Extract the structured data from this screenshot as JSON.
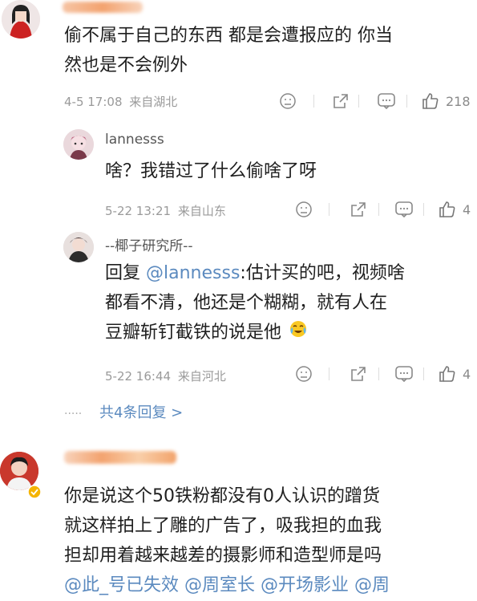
{
  "comment1": {
    "text_line1": "偷不属于自己的东西 都是会遭报应的 你当",
    "text_line2": "然也是不会例外",
    "time": "4-5 17:08",
    "location": "来自湖北",
    "likes": "218"
  },
  "reply1": {
    "username": "lannesss",
    "text": "啥？我错过了什么偷啥了呀",
    "time": "5-22 13:21",
    "location": "来自山东",
    "likes": "4"
  },
  "reply2": {
    "username": "--椰子研究所--",
    "prefix": "回复 ",
    "mention": "@lannesss",
    "text_line1_rest": ":估计买的吧，视频啥",
    "text_line2": "都看不清，他还是个糊糊，就有人在",
    "text_line3": "豆瓣斩钉截铁的说是他",
    "time": "5-22 16:44",
    "location": "来自河北",
    "likes": "4"
  },
  "replies_summary": {
    "dots": "·····",
    "label": "共4条回复 >"
  },
  "comment2": {
    "text_line1": "你是说这个50铁粉都没有0人认识的蹭货",
    "text_line2": "就这样拍上了雕的广告了，吸我担的血我",
    "text_line3": "担却用着越来越差的摄影师和造型师是吗",
    "mentions": [
      "@此_号已失效",
      "@周室长",
      "@开场影业",
      "@周"
    ]
  },
  "colors": {
    "mention": "#5b8abf",
    "meta": "#9a9a9a",
    "blur": "#f3a36f"
  }
}
